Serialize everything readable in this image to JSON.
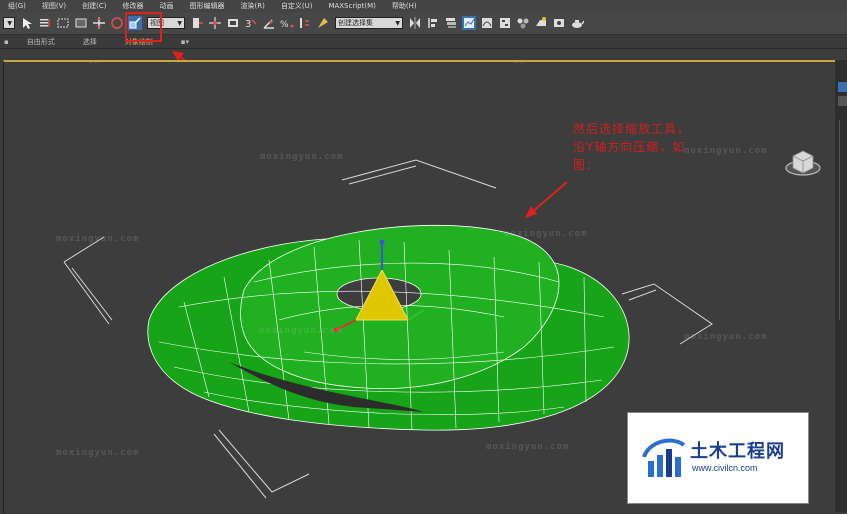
{
  "menu": {
    "items": [
      {
        "label": "组(G)"
      },
      {
        "label": "视图(V)"
      },
      {
        "label": "创建(C)"
      },
      {
        "label": "修改器"
      },
      {
        "label": "动画"
      },
      {
        "label": "图形编辑器"
      },
      {
        "label": "渲染(R)"
      },
      {
        "label": "自定义(U)"
      },
      {
        "label": "MAXScript(M)"
      },
      {
        "label": "帮助(H)"
      }
    ]
  },
  "toolbar": {
    "view_dropdown": "视图",
    "selection_set_dropdown": "创建选择集",
    "icons": [
      "select-icon",
      "select-region-icon",
      "window-crossing-icon",
      "move-icon",
      "rotate-icon",
      "scale-icon",
      "mirror-icon",
      "align-icon",
      "snap-icon",
      "angle-snap-icon",
      "percent-snap-icon",
      "spinner-snap-icon",
      "edit-named-sel-icon",
      "layer-icon",
      "graph-editor-icon",
      "schematic-icon",
      "material-editor-icon",
      "render-setup-icon",
      "render-frame-icon",
      "render-icon",
      "teapot-icon"
    ]
  },
  "ribbon": {
    "tabs": [
      {
        "label": "自由形式"
      },
      {
        "label": "选择"
      },
      {
        "label": "对象绘制"
      }
    ]
  },
  "annotation": {
    "text": "然后选择缩放工具，沿Y轴方向压缩，如图："
  },
  "watermarks": {
    "text": "moxingyun.com"
  },
  "logo": {
    "title": "土木工程网",
    "url": "www.civilcn.com"
  },
  "colors": {
    "torus_fill": "#1aa81a",
    "annotation": "#d02020",
    "viewport_border": "#c8a640",
    "highlight_box": "#e02020"
  }
}
